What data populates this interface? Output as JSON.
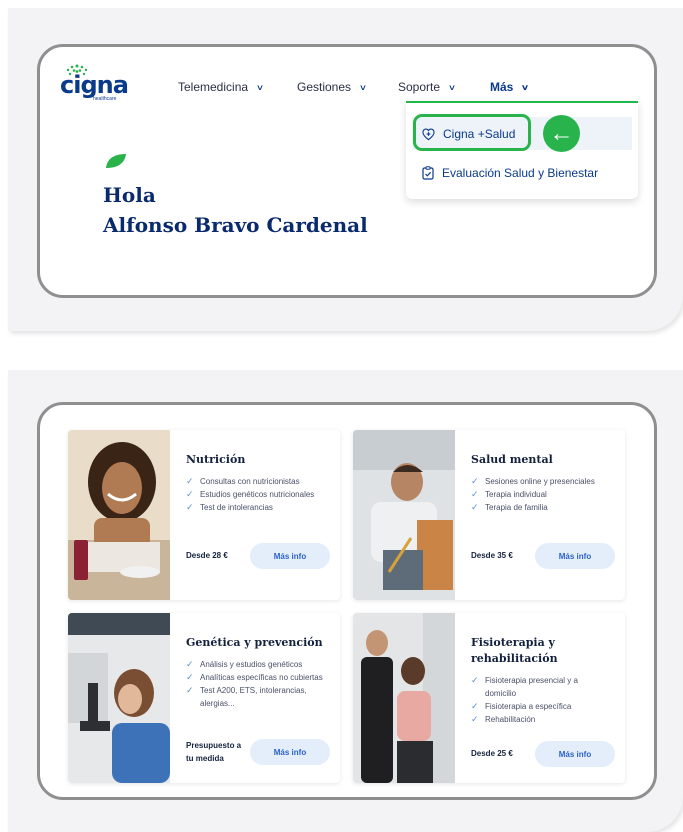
{
  "brand": {
    "name": "cigna",
    "sub": "healthcare"
  },
  "nav": [
    {
      "label": "Telemedicina"
    },
    {
      "label": "Gestiones"
    },
    {
      "label": "Soporte"
    },
    {
      "label": "Más"
    }
  ],
  "dropdown": {
    "items": [
      {
        "label": "Cigna +Salud",
        "icon": "heart-plus-icon"
      },
      {
        "label": "Evaluación Salud y Bienestar",
        "icon": "clipboard-check-icon"
      }
    ],
    "arrow": "←"
  },
  "greeting": {
    "line1": "Hola",
    "line2": "Alfonso Bravo Cardenal"
  },
  "cards": [
    {
      "title": "Nutrición",
      "items": [
        "Consultas con nutricionistas",
        "Estudios genéticos nutricionales",
        "Test de intolerancias"
      ],
      "price": "Desde 28 €",
      "button": "Más info"
    },
    {
      "title": "Salud mental",
      "items": [
        "Sesiones online y presenciales",
        "Terapia individual",
        "Terapia de familia"
      ],
      "price": "Desde 35 €",
      "button": "Más info"
    },
    {
      "title": "Genética y prevención",
      "items": [
        "Análisis y estudios genéticos",
        "Analíticas específicas no cubiertas",
        "Test A200, ETS, intolerancias, alergias..."
      ],
      "price": "Presupuesto a tu medida",
      "button": "Más info"
    },
    {
      "title": "Fisioterapia y rehabilitación",
      "items": [
        "Fisioterapia presencial y a domicilio",
        "Fisioterapia a específica",
        "Rehabilitación"
      ],
      "price": "Desde 25 €",
      "button": "Más info"
    }
  ],
  "colors": {
    "brand_navy": "#0a3a8a",
    "accent_green": "#29b34c",
    "button_bg": "#e4eefb"
  }
}
